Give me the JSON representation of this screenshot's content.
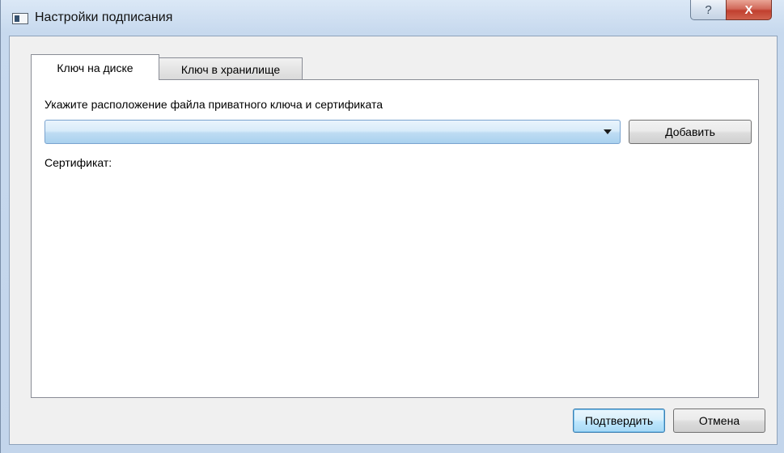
{
  "window": {
    "title": "Настройки подписания",
    "help_label": "?",
    "close_label": "X"
  },
  "tabs": [
    {
      "label": "Ключ на диске",
      "active": true
    },
    {
      "label": "Ключ в хранилище",
      "active": false
    }
  ],
  "panel": {
    "instruction": "Укажите расположение файла приватного ключа и сертификата",
    "key_path": {
      "value": ""
    },
    "add_label": "Добавить",
    "certificate_label": "Сертификат:"
  },
  "footer": {
    "confirm_label": "Подтвердить",
    "cancel_label": "Отмена"
  },
  "colors": {
    "title_bar": "#c7d9ee",
    "close_button": "#c1402f",
    "combo_accent": "#bedcf3",
    "default_button_border": "#3c7fb1"
  }
}
